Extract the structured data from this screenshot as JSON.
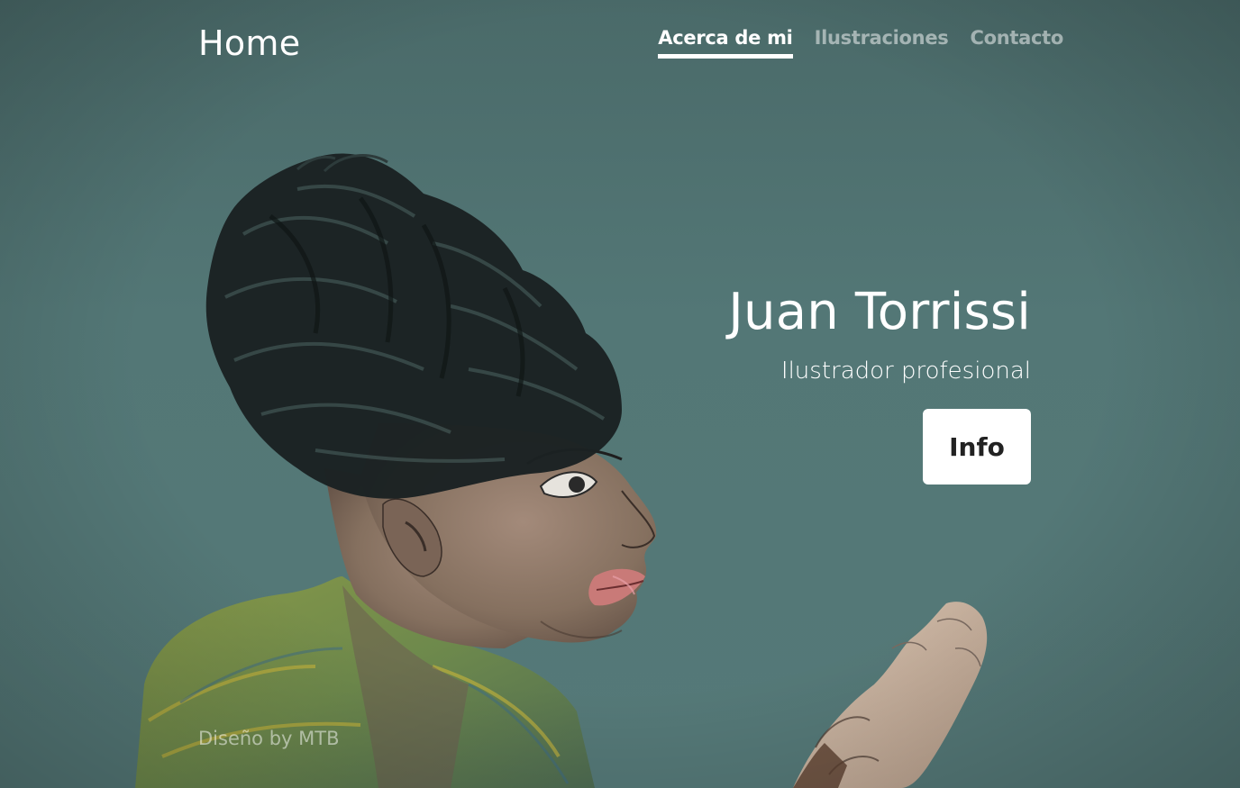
{
  "header": {
    "brand": "Home",
    "nav": [
      {
        "label": "Acerca de mi",
        "active": true
      },
      {
        "label": "Ilustraciones",
        "active": false
      },
      {
        "label": "Contacto",
        "active": false
      }
    ]
  },
  "hero": {
    "title": "Juan Torrissi",
    "subtitle": "Ilustrador profesional",
    "button_label": "Info"
  },
  "footer": {
    "credit": "Diseño by MTB"
  },
  "colors": {
    "background": "#537776",
    "text": "#ffffff",
    "button_bg": "#ffffff",
    "button_text": "#222222"
  }
}
